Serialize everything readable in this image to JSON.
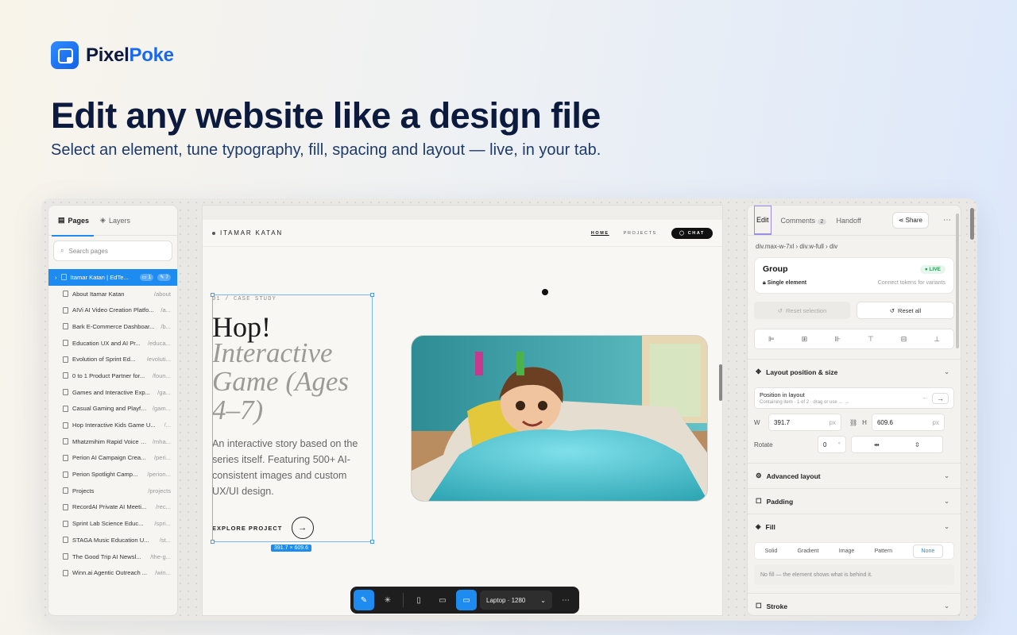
{
  "brand": {
    "name_a": "Pixel",
    "name_b": "Poke"
  },
  "hero": {
    "headline": "Edit any website like a design file",
    "subline": "Select an element, tune typography, fill, spacing and layout — live, in your tab."
  },
  "left_panel": {
    "tabs": {
      "pages": "Pages",
      "layers": "Layers"
    },
    "search_placeholder": "Search pages",
    "selected": {
      "name": "Itamar Katan | EdTe...",
      "c1": "1",
      "c2": "7"
    },
    "pages": [
      {
        "name": "About Itamar Katan",
        "path": "/about"
      },
      {
        "name": "AIVi AI Video Creation Platfo...",
        "path": "/a..."
      },
      {
        "name": "Bark E-Commerce Dashboar...",
        "path": "/b..."
      },
      {
        "name": "Education UX and AI Pr...",
        "path": "/educa..."
      },
      {
        "name": "Evolution of Sprint Ed...",
        "path": "/evoluti..."
      },
      {
        "name": "0 to 1 Product Partner for...",
        "path": "/foun..."
      },
      {
        "name": "Games and Interactive Exp...",
        "path": "/ga..."
      },
      {
        "name": "Casual Gaming and Playful...",
        "path": "/gam..."
      },
      {
        "name": "Hop Interactive Kids Game U...",
        "path": "/..."
      },
      {
        "name": "Mhatzmihim Rapid Voice F...",
        "path": "/mha..."
      },
      {
        "name": "Perion AI Campaign Crea...",
        "path": "/peri..."
      },
      {
        "name": "Perion Spotlight Camp...",
        "path": "/perion..."
      },
      {
        "name": "Projects",
        "path": "/projects"
      },
      {
        "name": "RecordAI Private AI Meeti...",
        "path": "/rec..."
      },
      {
        "name": "Sprint Lab Science Educ...",
        "path": "/spri..."
      },
      {
        "name": "STAGA Music Education U...",
        "path": "/st..."
      },
      {
        "name": "The Good Trip AI Newsl...",
        "path": "/the-g..."
      },
      {
        "name": "Winn.ai Agentic Outreach ...",
        "path": "/win..."
      }
    ]
  },
  "canvas": {
    "site": {
      "brand": "ITAMAR KATAN",
      "nav": {
        "home": "HOME",
        "projects": "PROJECTS",
        "chat": "CHAT"
      },
      "case": "01 / CASE STUDY",
      "title1": "Hop!",
      "title2": "Interactive Game (Ages 4–7)",
      "desc": "An interactive story based on the series itself. Featuring 500+ AI-consistent images and custom UX/UI design.",
      "cta": "EXPLORE PROJECT"
    },
    "dims": "391.7 × 609.6",
    "toolbar": {
      "device": "Laptop · 1280"
    }
  },
  "right_panel": {
    "tabs": {
      "edit": "Edit",
      "comments": "Comments",
      "comments_count": "2",
      "handoff": "Handoff",
      "share": "Share"
    },
    "breadcrumb": "div.max-w-7xl › div.w-full › div",
    "group": {
      "title": "Group",
      "live": "LIVE",
      "single": "Single element",
      "tokens": "Connect tokens for variants"
    },
    "reset_selection": "Reset selection",
    "reset_all": "Reset all",
    "layout": {
      "title": "Layout position & size",
      "pos_title": "Position in layout",
      "pos_sub": "Containing item · 1 of 2 · drag or use ← →",
      "w_label": "W",
      "w": "391.7",
      "h_label": "H",
      "h": "609.6",
      "unit": "px",
      "rotate_label": "Rotate",
      "rotate": "0",
      "deg": "°"
    },
    "sections": {
      "advanced": "Advanced layout",
      "padding": "Padding",
      "fill": "Fill",
      "stroke": "Stroke"
    },
    "fill": {
      "tabs": [
        "Solid",
        "Gradient",
        "Image",
        "Pattern",
        "None"
      ],
      "note": "No fill — the element shows what is behind it."
    }
  }
}
